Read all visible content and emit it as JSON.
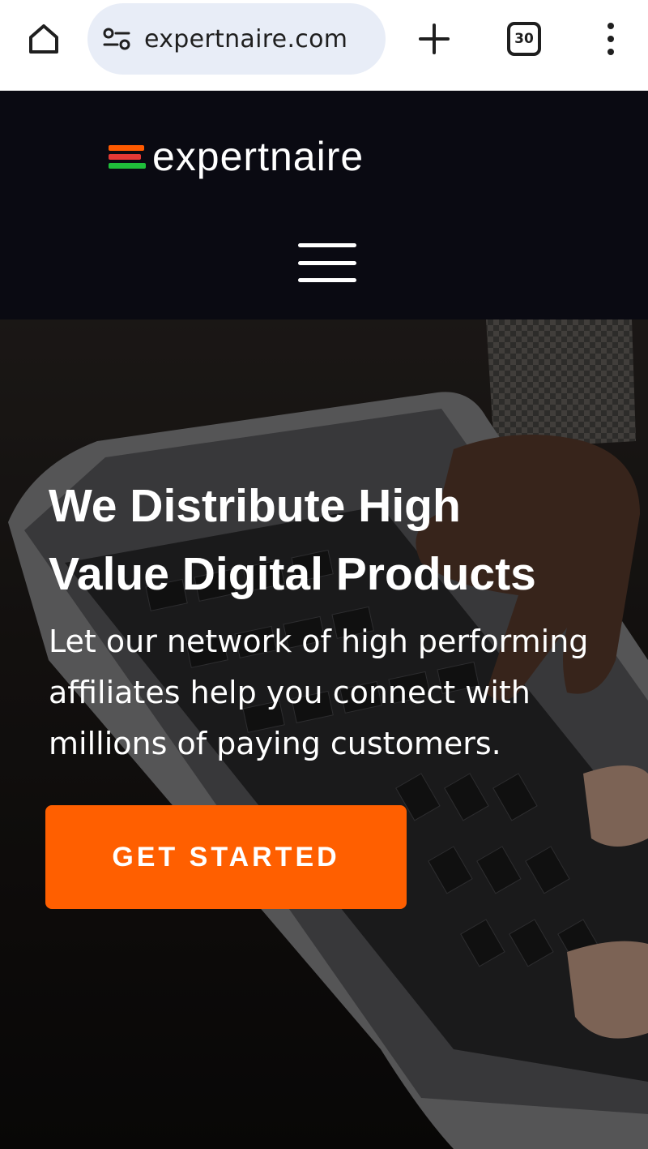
{
  "browser": {
    "url": "expertnaire.com",
    "tab_count": "30",
    "icons": {
      "home": "home-icon",
      "site_info": "site-settings-icon",
      "new_tab": "plus-icon",
      "menu": "more-vert-icon"
    }
  },
  "site": {
    "logo_text": "expertnaire",
    "logo_bar_colors": [
      "#ff5a00",
      "#e53935",
      "#1fbf3a"
    ],
    "menu_icon": "hamburger-icon"
  },
  "hero": {
    "title_line1": "We Distribute High",
    "title_line2": "Value Digital Products",
    "subtitle": "Let our network of high performing affiliates help you connect with millions of paying customers.",
    "cta_label": "GET STARTED"
  },
  "colors": {
    "header_bg": "#0a0a12",
    "accent": "#ff5f00",
    "url_pill_bg": "#e8edf7"
  }
}
